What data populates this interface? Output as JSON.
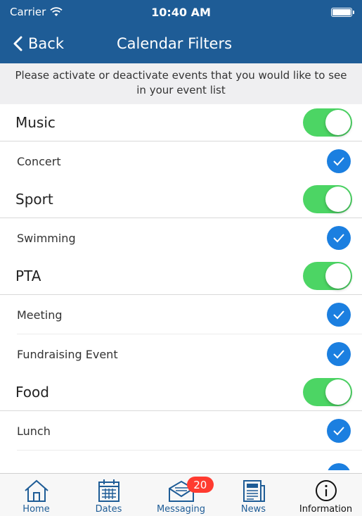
{
  "status": {
    "carrier": "Carrier",
    "time": "10:40 AM"
  },
  "nav": {
    "back_label": "Back",
    "title": "Calendar Filters"
  },
  "banner": {
    "text": "Please activate or deactivate events that you would like to see in your event list"
  },
  "colors": {
    "accent": "#1e5c96",
    "toggle_on": "#4cd564",
    "check": "#1b7fe0",
    "badge": "#ff3b30"
  },
  "categories": [
    {
      "label": "Music",
      "enabled": true,
      "items": [
        {
          "label": "Concert",
          "checked": true
        }
      ]
    },
    {
      "label": "Sport",
      "enabled": true,
      "items": [
        {
          "label": "Swimming",
          "checked": true
        }
      ]
    },
    {
      "label": "PTA",
      "enabled": true,
      "items": [
        {
          "label": "Meeting",
          "checked": true
        },
        {
          "label": "Fundraising Event",
          "checked": true
        }
      ]
    },
    {
      "label": "Food",
      "enabled": true,
      "items": [
        {
          "label": "Lunch",
          "checked": true
        }
      ]
    }
  ],
  "tabs": [
    {
      "label": "Home",
      "icon": "home-icon"
    },
    {
      "label": "Dates",
      "icon": "calendar-icon"
    },
    {
      "label": "Messaging",
      "icon": "envelope-icon",
      "badge": "20"
    },
    {
      "label": "News",
      "icon": "newspaper-icon"
    },
    {
      "label": "Information",
      "icon": "info-icon",
      "active": true
    }
  ]
}
